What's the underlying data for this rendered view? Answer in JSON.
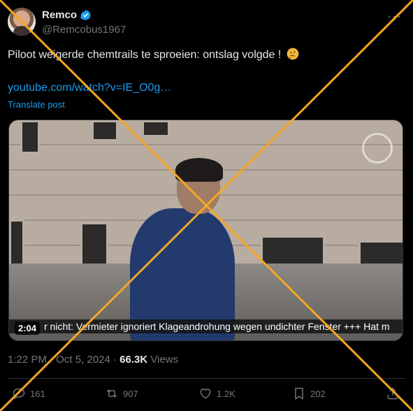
{
  "author": {
    "name": "Remco",
    "handle": "@Remcobus1967",
    "verified": true
  },
  "tweet": {
    "text": "Piloot weigerde chemtrails te sproeien: ontslag volgde !",
    "emoji": "thinking-face-icon",
    "link": "youtube.com/watch?v=IE_O0g…",
    "translate_label": "Translate post"
  },
  "media": {
    "duration": "2:04",
    "ticker": "r nicht: Vermieter ignoriert Klageandrohung wegen undichter Fenster +++ Hat m"
  },
  "meta": {
    "time": "1:22 PM",
    "sep": "·",
    "date": "Oct 5, 2024",
    "sep2": "·",
    "views_count": "66.3K",
    "views_label": "Views"
  },
  "actions": {
    "replies": "161",
    "reposts": "907",
    "likes": "1.2K",
    "bookmarks": "202"
  },
  "colors": {
    "accent": "#1d9bf0",
    "overlay_cross": "#f5a623",
    "background": "#000000"
  }
}
